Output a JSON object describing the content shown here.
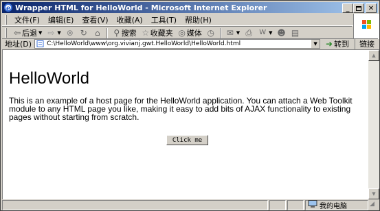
{
  "window": {
    "title": "Wrapper HTML for HelloWorld - Microsoft Internet Explorer"
  },
  "menu": {
    "items": [
      "文件(F)",
      "编辑(E)",
      "查看(V)",
      "收藏(A)",
      "工具(T)",
      "帮助(H)"
    ]
  },
  "toolbar": {
    "back_label": "后退",
    "search_label": "搜索",
    "favorites_label": "收藏夹",
    "media_label": "媒体"
  },
  "address": {
    "label": "地址(D)",
    "url": "C:\\HelloWorld\\www\\org.vivianj.gwt.HelloWorld\\HelloWorld.html",
    "go_label": "转到",
    "links_label": "链接"
  },
  "page": {
    "heading": "HelloWorld",
    "paragraph": "This is an example of a host page for the HelloWorld application. You can attach a Web Toolkit module to any HTML page you like, making it easy to add bits of AJAX functionality to existing pages without starting from scratch.",
    "button_label": "Click me"
  },
  "status": {
    "zone_label": "我的电脑"
  }
}
